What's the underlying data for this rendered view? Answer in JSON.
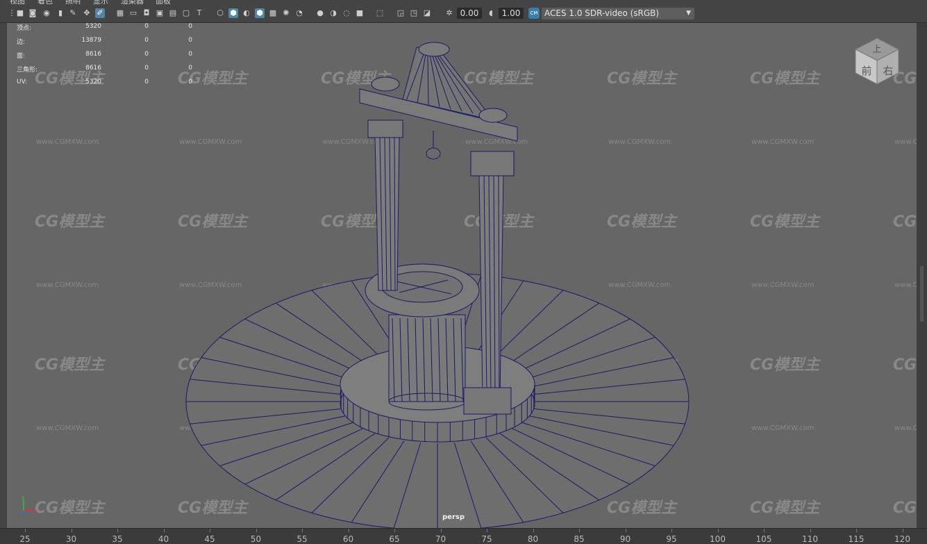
{
  "menu": {
    "items": [
      "视图",
      "着色",
      "照明",
      "显示",
      "渲染器",
      "面板"
    ]
  },
  "toolbar": {
    "exposure_value": "0.00",
    "gamma_value": "1.00",
    "color_management": "ACES 1.0 SDR-video (sRGB)"
  },
  "hud": {
    "rows": [
      {
        "label": "顶点:",
        "values": [
          "5320",
          "0",
          "0"
        ]
      },
      {
        "label": "边:",
        "values": [
          "13879",
          "0",
          "0"
        ]
      },
      {
        "label": "面:",
        "values": [
          "8616",
          "0",
          "0"
        ]
      },
      {
        "label": "三角形:",
        "values": [
          "8616",
          "0",
          "0"
        ]
      },
      {
        "label": "UV:",
        "values": [
          "5320",
          "0",
          "0"
        ]
      }
    ]
  },
  "viewcube": {
    "top": "上",
    "front": "前",
    "right": "右"
  },
  "viewport": {
    "camera": "persp"
  },
  "axis_labels": {
    "y": "y",
    "x": "x",
    "z": "z"
  },
  "watermark": {
    "logo": "CG模型主",
    "url": "www.CGMXW.com"
  },
  "ruler": {
    "ticks": [
      "25",
      "30",
      "35",
      "40",
      "45",
      "50",
      "55",
      "60",
      "65",
      "70",
      "75",
      "80",
      "85",
      "90",
      "95",
      "100",
      "105",
      "110",
      "115",
      "120"
    ]
  },
  "colors": {
    "viewport_bg": "#666666",
    "wireframe": "#1a1a66",
    "highlight": "#5285a6"
  }
}
